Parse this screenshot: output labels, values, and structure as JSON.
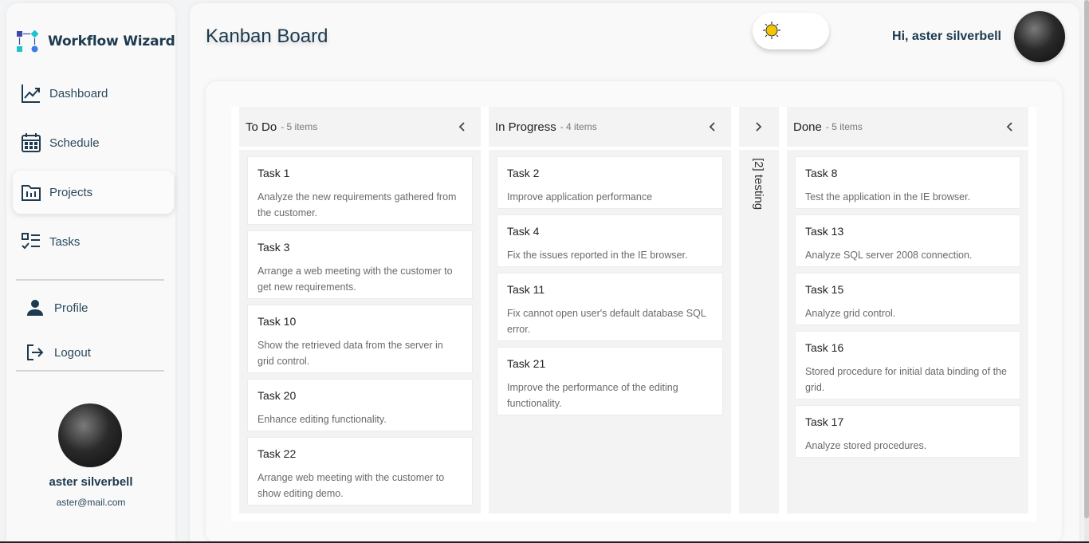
{
  "app": {
    "name": "Workflow Wizard"
  },
  "sidebar": {
    "items": [
      {
        "label": "Dashboard",
        "icon": "chart-line-icon"
      },
      {
        "label": "Schedule",
        "icon": "calendar-icon"
      },
      {
        "label": "Projects",
        "icon": "projects-folder-icon",
        "active": true
      },
      {
        "label": "Tasks",
        "icon": "checklist-icon"
      }
    ],
    "account": [
      {
        "label": "Profile",
        "icon": "person-icon"
      },
      {
        "label": "Logout",
        "icon": "logout-icon"
      }
    ],
    "user": {
      "name": "aster silverbell",
      "email": "aster@mail.com"
    }
  },
  "header": {
    "title": "Kanban Board",
    "greeting": "Hi, aster silverbell",
    "theme_icon": "sun-icon"
  },
  "board": {
    "columns": [
      {
        "title": "To Do",
        "count": "- 5 items",
        "cards": [
          {
            "title": "Task 1",
            "desc": "Analyze the new requirements gathered from the customer."
          },
          {
            "title": "Task 3",
            "desc": "Arrange a web meeting with the customer to get new requirements."
          },
          {
            "title": "Task 10",
            "desc": "Show the retrieved data from the server in grid control."
          },
          {
            "title": "Task 20",
            "desc": "Enhance editing functionality."
          },
          {
            "title": "Task 22",
            "desc": "Arrange web meeting with the customer to show editing demo."
          }
        ]
      },
      {
        "title": "In Progress",
        "count": "- 4 items",
        "cards": [
          {
            "title": "Task 2",
            "desc": "Improve application performance"
          },
          {
            "title": "Task 4",
            "desc": "Fix the issues reported in the IE browser."
          },
          {
            "title": "Task 11",
            "desc": "Fix cannot open user's default database SQL error."
          },
          {
            "title": "Task 21",
            "desc": "Improve the performance of the editing functionality."
          }
        ]
      },
      {
        "title": "Done",
        "count": "- 5 items",
        "cards": [
          {
            "title": "Task 8",
            "desc": "Test the application in the IE browser."
          },
          {
            "title": "Task 13",
            "desc": "Analyze SQL server 2008 connection."
          },
          {
            "title": "Task 15",
            "desc": "Analyze grid control."
          },
          {
            "title": "Task 16",
            "desc": "Stored procedure for initial data binding of the grid."
          },
          {
            "title": "Task 17",
            "desc": "Analyze stored procedures."
          }
        ]
      }
    ],
    "collapsed": {
      "label": "[2] testing"
    }
  }
}
